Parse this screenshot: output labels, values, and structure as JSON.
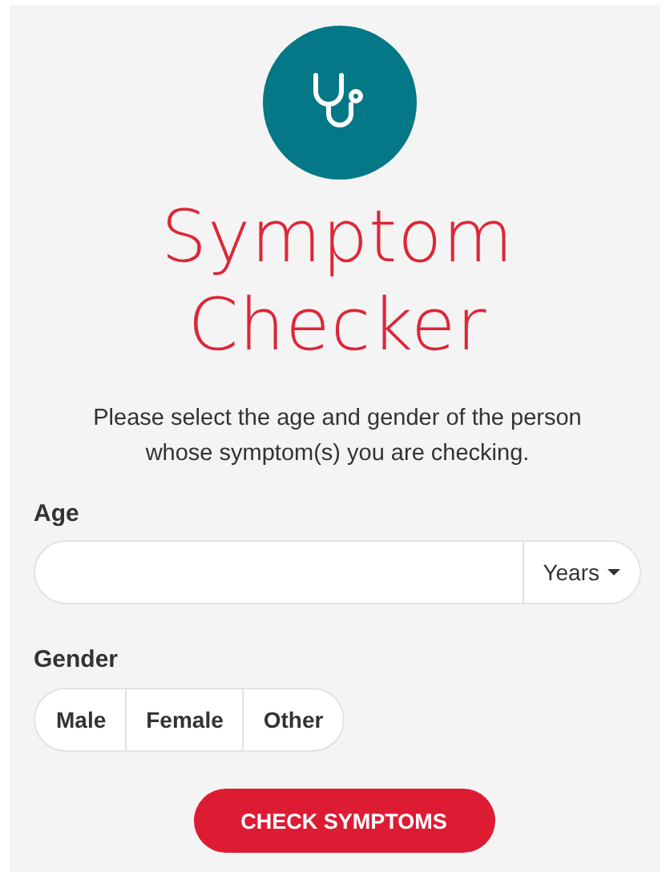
{
  "title_lines": [
    "Symptom",
    "Checker"
  ],
  "instructions": "Please select the age and gender of the person whose symptom(s) you are checking.",
  "age": {
    "label": "Age",
    "unit": "Years"
  },
  "gender": {
    "label": "Gender",
    "options": [
      {
        "label": "Male",
        "selected": false
      },
      {
        "label": "Female",
        "selected": false
      },
      {
        "label": "Other",
        "selected": false
      }
    ]
  },
  "submit": "CHECK SYMPTOMS"
}
